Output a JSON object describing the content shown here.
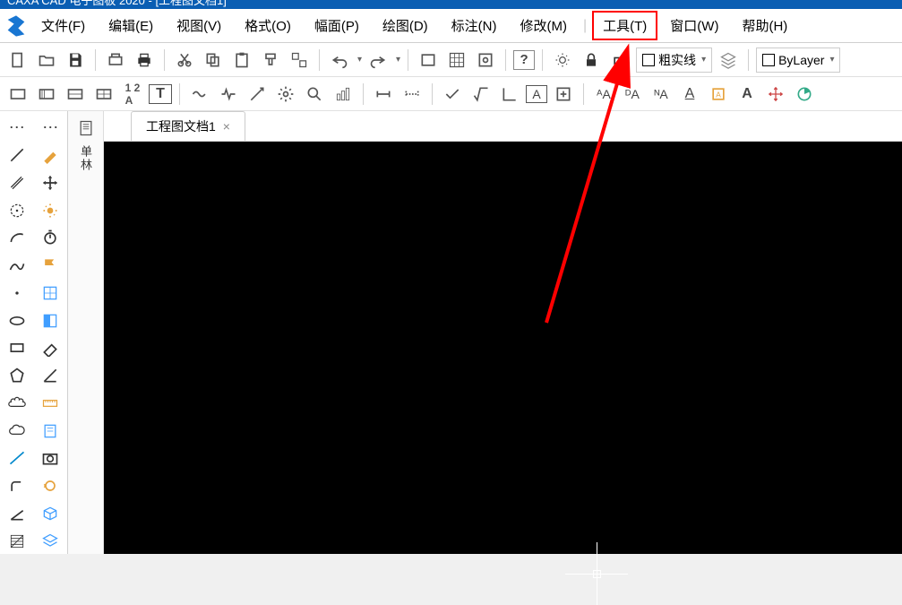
{
  "titlebar": "CAXA CAD 电子图板 2020 - [工程图文档1]",
  "menu": {
    "file": "文件(F)",
    "edit": "编辑(E)",
    "view": "视图(V)",
    "format": "格式(O)",
    "page": "幅面(P)",
    "draw": "绘图(D)",
    "annotate": "标注(N)",
    "modify": "修改(M)",
    "tools": "工具(T)",
    "window": "窗口(W)",
    "help": "帮助(H)"
  },
  "toolbar2": {
    "linetype": "粗实线",
    "layer": "ByLayer"
  },
  "sidestrip": {
    "label": "单林"
  },
  "tab": {
    "name": "工程图文档1",
    "close": "×"
  }
}
